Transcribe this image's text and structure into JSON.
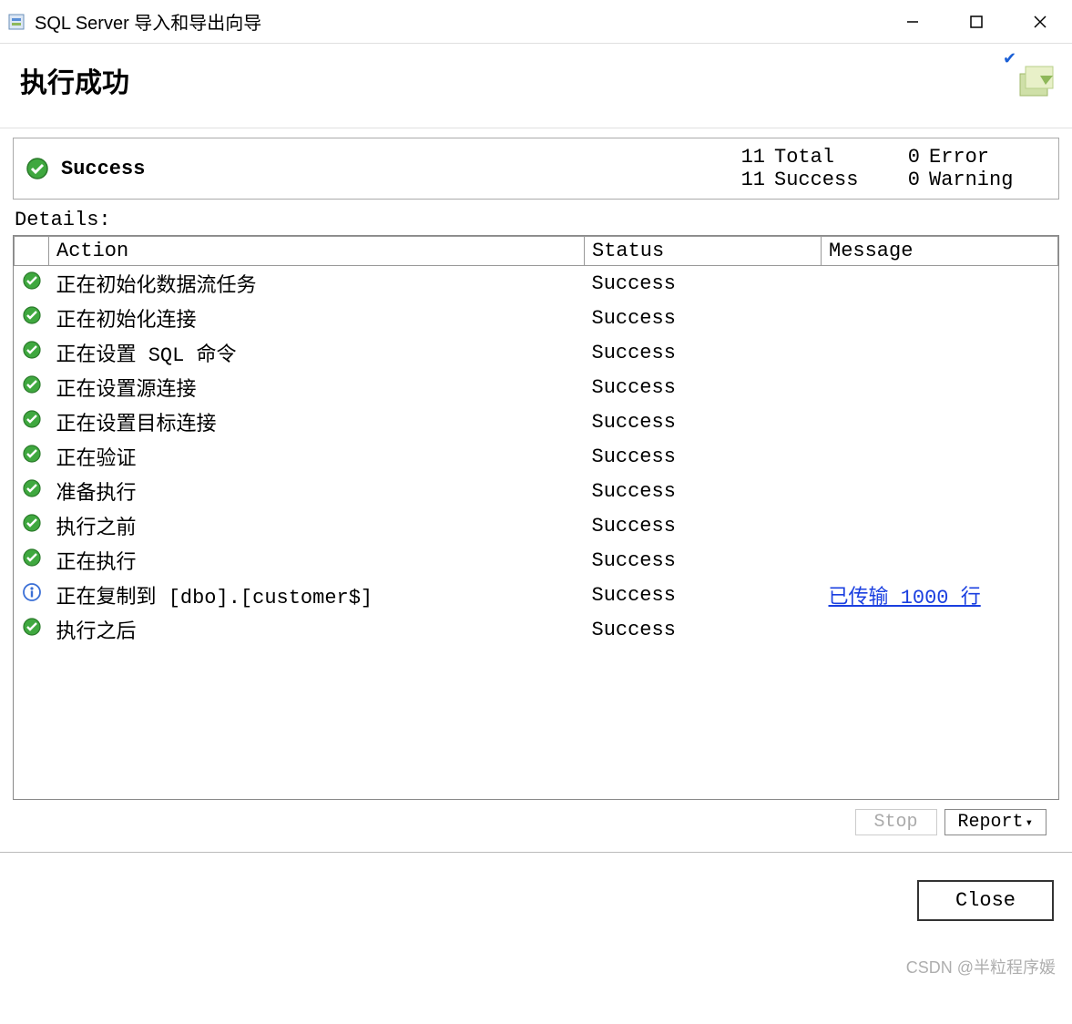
{
  "window": {
    "title": "SQL Server 导入和导出向导"
  },
  "header": {
    "heading": "执行成功"
  },
  "summary": {
    "status_label": "Success",
    "total_count": "11",
    "total_label": "Total",
    "error_count": "0",
    "error_label": "Error",
    "success_count": "11",
    "success_label": "Success",
    "warning_count": "0",
    "warning_label": "Warning"
  },
  "details_label": "Details:",
  "columns": {
    "action": "Action",
    "status": "Status",
    "message": "Message"
  },
  "rows": [
    {
      "icon": "success",
      "action": "正在初始化数据流任务",
      "status": "Success",
      "message": ""
    },
    {
      "icon": "success",
      "action": "正在初始化连接",
      "status": "Success",
      "message": ""
    },
    {
      "icon": "success",
      "action": "正在设置 SQL 命令",
      "status": "Success",
      "message": ""
    },
    {
      "icon": "success",
      "action": "正在设置源连接",
      "status": "Success",
      "message": ""
    },
    {
      "icon": "success",
      "action": "正在设置目标连接",
      "status": "Success",
      "message": ""
    },
    {
      "icon": "success",
      "action": "正在验证",
      "status": "Success",
      "message": ""
    },
    {
      "icon": "success",
      "action": "准备执行",
      "status": "Success",
      "message": ""
    },
    {
      "icon": "success",
      "action": "执行之前",
      "status": "Success",
      "message": ""
    },
    {
      "icon": "success",
      "action": "正在执行",
      "status": "Success",
      "message": ""
    },
    {
      "icon": "info",
      "action": "正在复制到 [dbo].[customer$]",
      "status": "Success",
      "message": "已传输 1000 行",
      "is_link": true
    },
    {
      "icon": "success",
      "action": "执行之后",
      "status": "Success",
      "message": ""
    }
  ],
  "buttons": {
    "stop": "Stop",
    "report": "Report",
    "close": "Close"
  },
  "watermark": "CSDN @半粒程序媛"
}
